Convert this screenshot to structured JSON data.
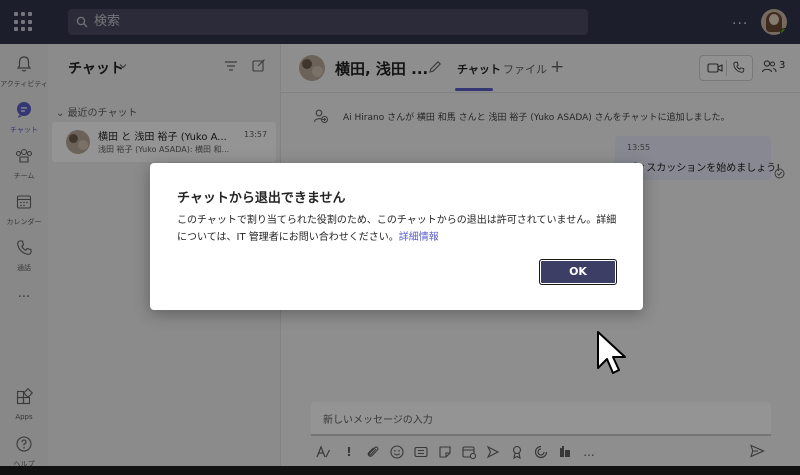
{
  "search": {
    "placeholder": "検索"
  },
  "top": {
    "more": "..."
  },
  "rail": {
    "items": [
      {
        "label": "アクティビティ"
      },
      {
        "label": "チャット"
      },
      {
        "label": "チーム"
      },
      {
        "label": "カレンダー"
      },
      {
        "label": "通話"
      },
      {
        "label": "..."
      },
      {
        "label": "Apps"
      },
      {
        "label": "ヘルプ"
      }
    ]
  },
  "list": {
    "title": "チャット",
    "recent_header": "最近のチャット",
    "chats": [
      {
        "name": "横田 と 浅田 裕子 (Yuko A...",
        "time": "13:57",
        "preview": "浅田 裕子 (Yuko ASADA): 横田 和..."
      }
    ]
  },
  "chat": {
    "title": "横田, 浅田 ...",
    "tabs": [
      {
        "label": "チャット"
      },
      {
        "label": "ファイル"
      }
    ],
    "add_tab": "+",
    "participant_count": "3",
    "system_message": "Ai Hirano さんが 横田 和馬 さんと 浅田 裕子 (Yuko ASADA) さんをチャットに追加しました。",
    "message": {
      "time": "13:55",
      "text": "ディスカッションを始めましょう!"
    },
    "compose_placeholder": "新しいメッセージの入力",
    "toolbar_more": "..."
  },
  "dialog": {
    "title": "チャットから退出できません",
    "body": "このチャットで割り当てられた役割のため、このチャットからの退出は許可されていません。詳細については、IT 管理者にお問い合わせください。",
    "link": "詳細情報",
    "ok_label": "OK"
  },
  "colors": {
    "top_bar": "#33344a",
    "accent": "#5b5fc7",
    "ok_button": "#3d3e66"
  }
}
